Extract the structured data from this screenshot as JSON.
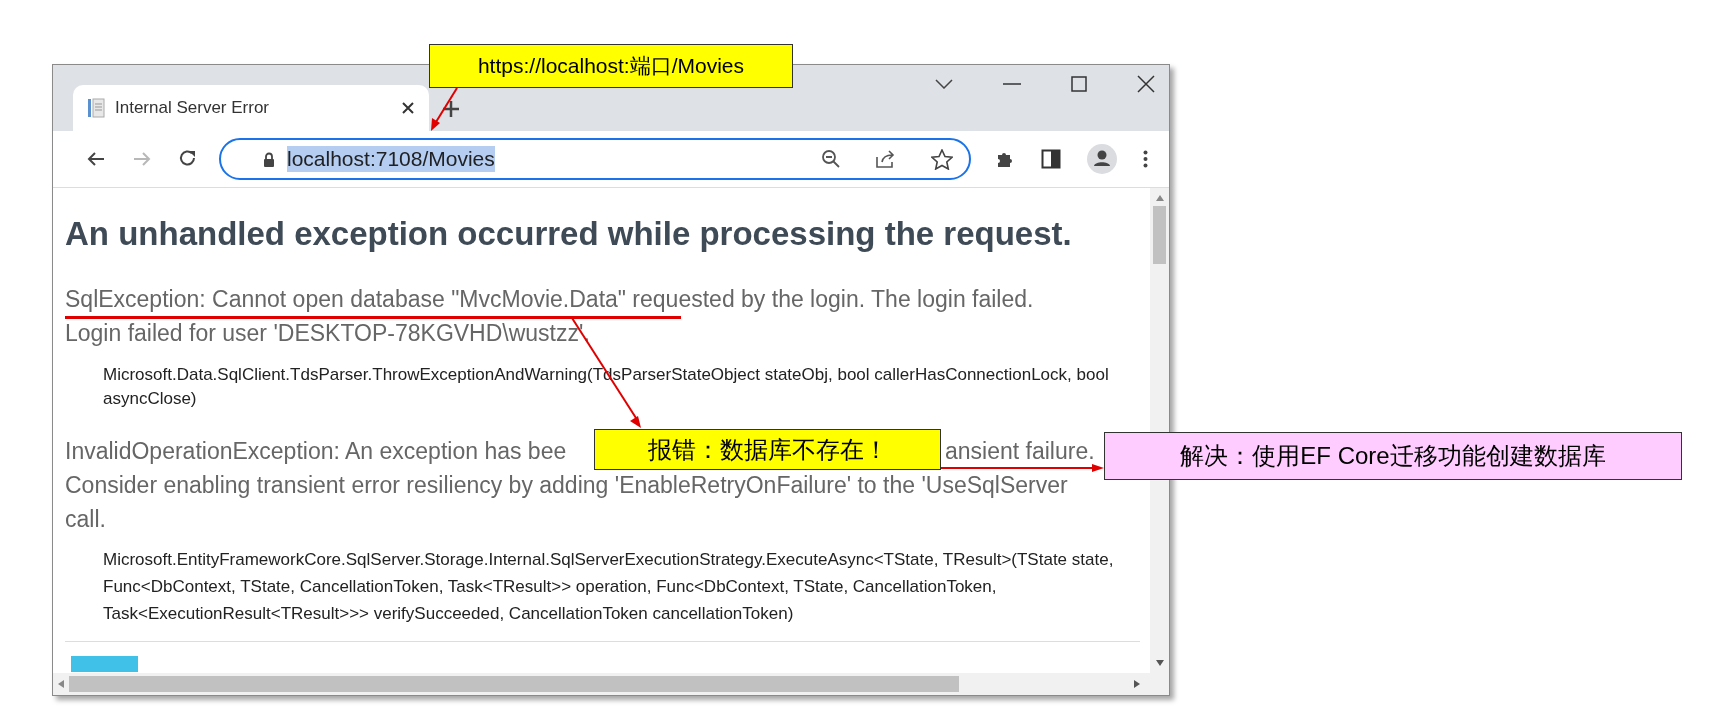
{
  "annotations": [
    {
      "text": "https://localhost:端口/Movies",
      "color": "#ffff00"
    },
    {
      "text": "报错：数据库不存在！",
      "color": "#ffff00"
    },
    {
      "text": "解决：使用EF Core迁移功能创建数据库",
      "color": "#ffccff"
    }
  ],
  "browser": {
    "tabs": [
      {
        "title": "Internal Server Error",
        "selected": true
      }
    ],
    "nav_buttons": [
      {
        "kind": "back",
        "disabled": false
      },
      {
        "kind": "forward",
        "disabled": true
      },
      {
        "kind": "reload",
        "disabled": false
      }
    ],
    "address_bar": {
      "value": "localhost:7108/Movies",
      "highlighted": true
    }
  },
  "page": {
    "heading": "An unhandled exception occurred while processing the request.",
    "errors": [
      {
        "message_lines": [
          [
            "SqlException: Cannot open database \"MvcMovie.Data\" requested by the login. The login failed."
          ],
          [
            "Login failed for user 'DESKTOP-78KGVHD\\wustzz'."
          ]
        ],
        "stack_lines": [
          "Microsoft.Data.SqlClient.TdsParser.ThrowExceptionAndWarning(TdsParserStateObject stateObj, bool callerHasConnectionLock, bool",
          "asyncClose)"
        ]
      },
      {
        "message_lines": [
          [
            "InvalidOperationException: An exception has bee",
            "ansient failure."
          ],
          [
            "Consider enabling transient error resiliency by adding 'EnableRetryOnFailure' to the 'UseSqlServer"
          ],
          [
            "call."
          ]
        ],
        "stack_lines": [
          "Microsoft.EntityFrameworkCore.SqlServer.Storage.Internal.SqlServerExecutionStrategy.ExecuteAsync<TState, TResult>(TState state,",
          "Func<DbContext, TState, CancellationToken, Task<TResult>> operation, Func<DbContext, TState, CancellationToken,",
          "Task<ExecutionResult<TResult>>> verifySucceeded, CancellationToken cancellationToken)"
        ]
      }
    ]
  }
}
